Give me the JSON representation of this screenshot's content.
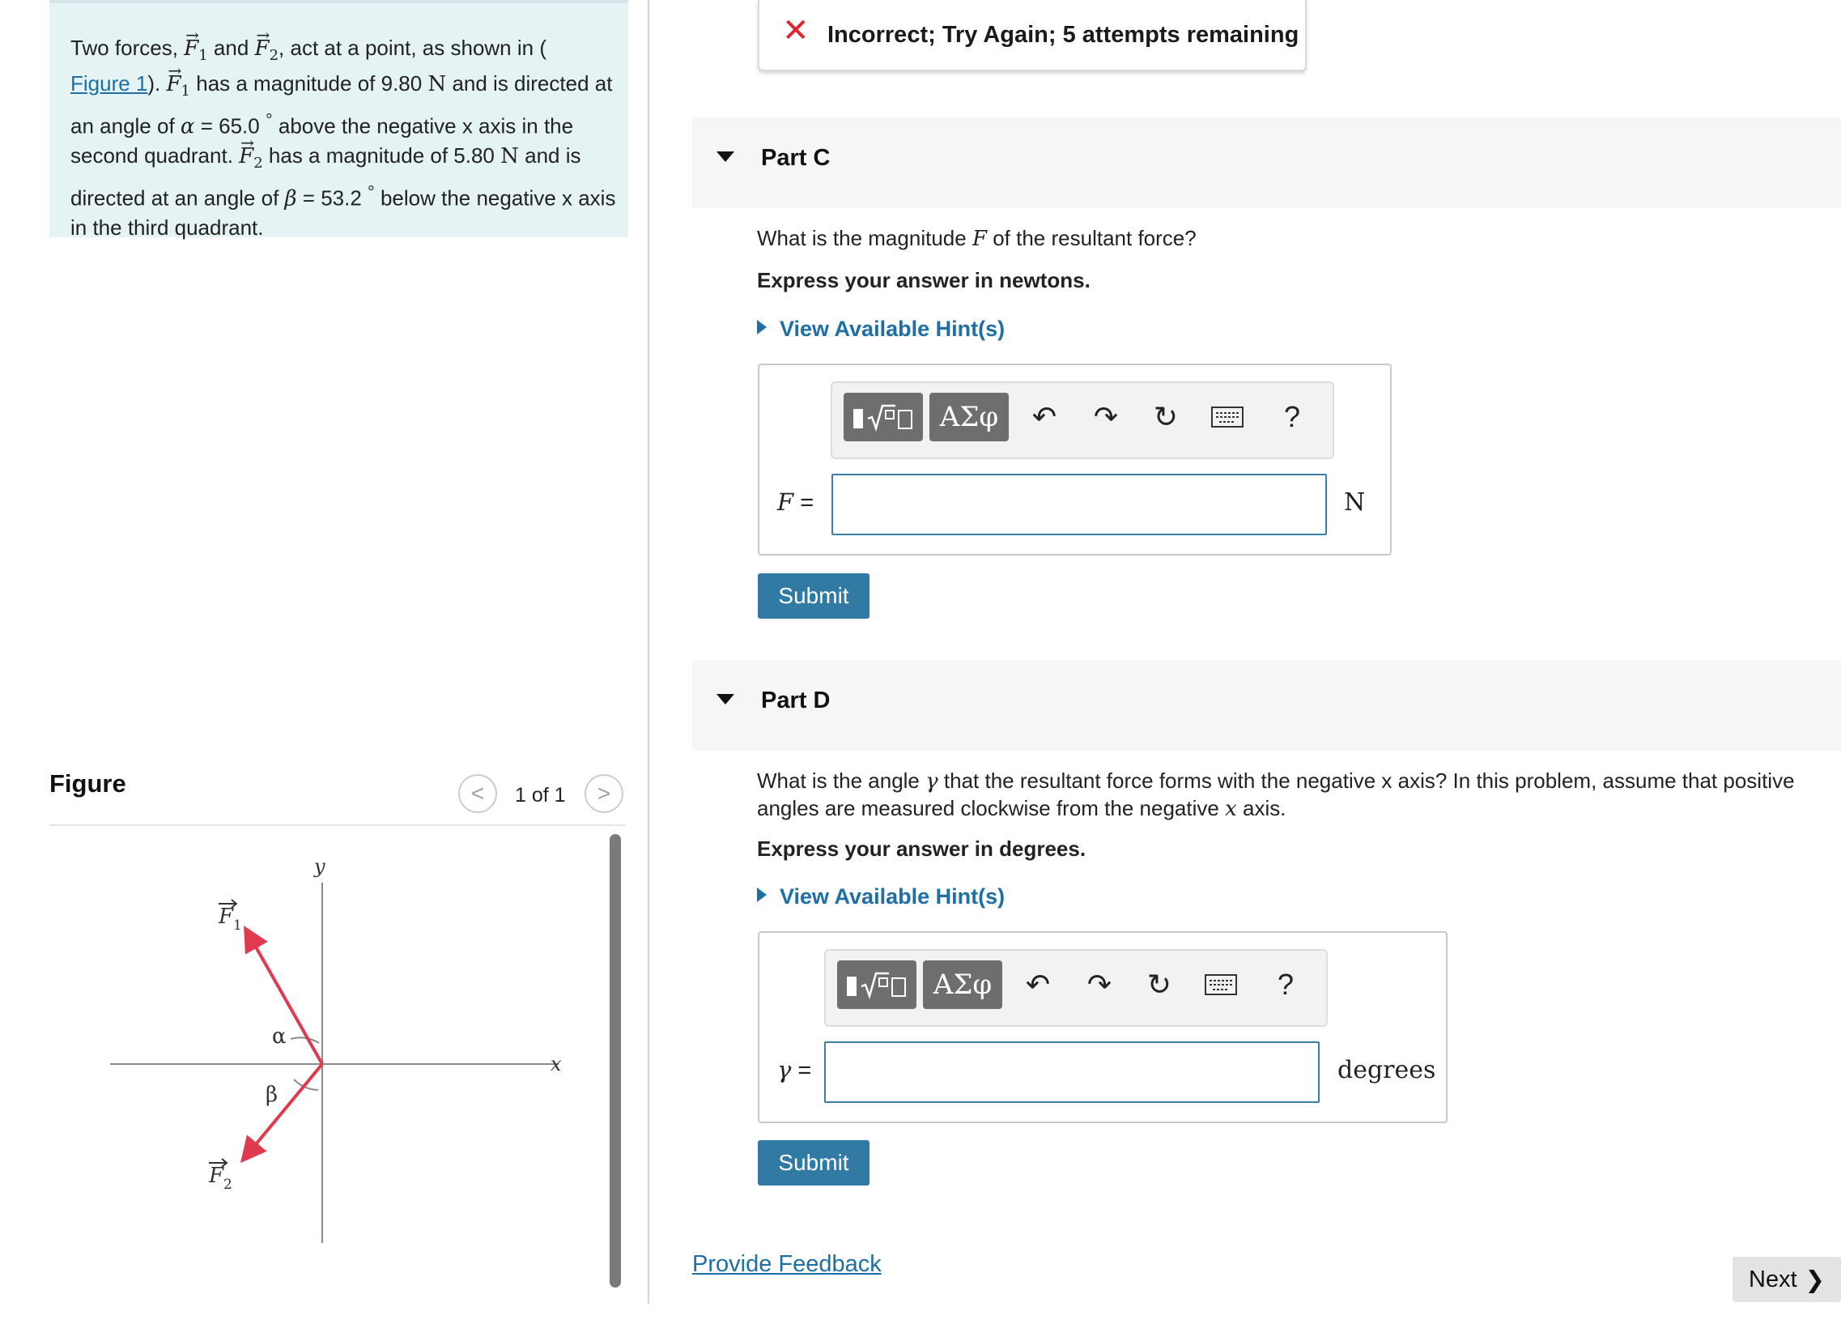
{
  "problem": {
    "text_intro": "Two forces,",
    "text_and": "and",
    "text_act": ", act at a point, as shown in (",
    "figure_link": "Figure 1",
    "text_f1_has": "). ",
    "text_f1_mag": "has a magnitude of 9.80",
    "unit_N": "N",
    "text_f1_dir": "and is directed at an angle of",
    "alpha_symbol": "α",
    "alpha_value": "= 65.0",
    "degree": "°",
    "text_f1_quad": "above the negative x axis in the second quadrant.",
    "text_f2_mag": "has a magnitude of 5.80",
    "text_f2_dir": "and is directed at an angle of",
    "beta_symbol": "β",
    "beta_value": "= 53.2",
    "text_f2_quad": "below the negative x axis in the third quadrant.",
    "vec_F": "F",
    "sub_1": "1",
    "sub_2": "2"
  },
  "figure": {
    "heading": "Figure",
    "pager_prev": "<",
    "pager_next": ">",
    "pager_count": "1 of 1",
    "axis_y": "y",
    "axis_x": "x",
    "label_alpha": "α",
    "label_beta": "β",
    "label_F": "F",
    "label_sub1": "1",
    "label_sub2": "2",
    "arrow_color": "#e03a4e"
  },
  "alert": {
    "icon": "close-x-icon",
    "text": "Incorrect; Try Again; 5 attempts remaining",
    "color": "#e0222f"
  },
  "part_c": {
    "title": "Part C",
    "question_pre": "What is the magnitude",
    "question_var": "F",
    "question_post": "of the resultant force?",
    "instruction": "Express your answer in newtons.",
    "hint": "View Available Hint(s)",
    "toolbar_greek": "ΑΣφ",
    "toolbar_help": "?",
    "answer_label": "F",
    "equals": "=",
    "answer_value": "",
    "unit": "N",
    "submit": "Submit"
  },
  "part_d": {
    "title": "Part D",
    "question_pre": "What is the angle",
    "question_var": "γ",
    "question_mid": "that the resultant force forms with the negative x axis? In this problem, assume that positive angles are measured  clockwise from the negative",
    "question_var2": "x",
    "question_post": "axis.",
    "instruction": "Express your answer in degrees.",
    "hint": "View Available Hint(s)",
    "toolbar_greek": "ΑΣφ",
    "toolbar_help": "?",
    "answer_label": "γ",
    "equals": "=",
    "answer_value": "",
    "unit": "degrees",
    "submit": "Submit"
  },
  "footer": {
    "feedback": "Provide Feedback",
    "next": "Next",
    "next_icon": "chevron-right-icon"
  },
  "colors": {
    "accent": "#317aa4",
    "link": "#1d6fa5",
    "problem_bg": "#e5f3f5"
  }
}
